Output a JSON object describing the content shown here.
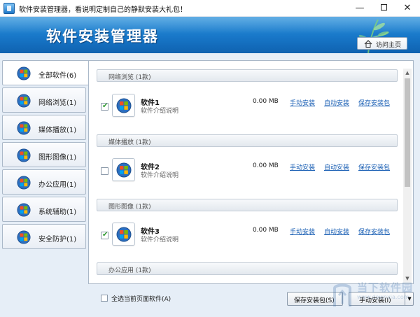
{
  "window": {
    "title": "软件安装管理器，看说明定制自己的静默安装大礼包！",
    "controls": {
      "minimize": "—",
      "maximize": "",
      "close": "✕"
    }
  },
  "banner": {
    "title": "软件安装管理器",
    "home_button": "访问主页",
    "colors": {
      "top": "#2e93dc",
      "bottom": "#0f62b0"
    }
  },
  "sidebar": {
    "items": [
      {
        "label": "全部软件(6)",
        "icon": "windows-logo-icon"
      },
      {
        "label": "网络浏览(1)",
        "icon": "windows-logo-icon"
      },
      {
        "label": "媒体播放(1)",
        "icon": "windows-logo-icon"
      },
      {
        "label": "图形图像(1)",
        "icon": "windows-logo-icon"
      },
      {
        "label": "办公应用(1)",
        "icon": "windows-logo-icon"
      },
      {
        "label": "系统辅助(1)",
        "icon": "windows-logo-icon"
      },
      {
        "label": "安全防护(1)",
        "icon": "windows-logo-icon"
      }
    ],
    "selected": "全部软件(6)"
  },
  "categories": [
    {
      "header": "网络浏览 (1款)"
    },
    {
      "header": "媒体播放 (1款)"
    },
    {
      "header": "图形图像 (1款)"
    },
    {
      "header": "办公应用 (1款)"
    }
  ],
  "software": [
    {
      "name": "软件1",
      "desc": "软件介绍说明",
      "size": "0.00 MB",
      "checked": true,
      "check_mark": "✔",
      "manual": "手动安装",
      "auto": "自动安装",
      "save": "保存安装包"
    },
    {
      "name": "软件2",
      "desc": "软件介绍说明",
      "size": "0.00 MB",
      "checked": false,
      "check_mark": "",
      "manual": "手动安装",
      "auto": "自动安装",
      "save": "保存安装包"
    },
    {
      "name": "软件3",
      "desc": "软件介绍说明",
      "size": "0.00 MB",
      "checked": true,
      "check_mark": "✔",
      "manual": "手动安装",
      "auto": "自动安装",
      "save": "保存安装包"
    }
  ],
  "footer": {
    "select_all": "全选当前页面软件(A)",
    "save_button": "保存安装包(S)",
    "manual_button": "手动安装(I)",
    "dropdown_caret": "▼"
  },
  "scrollbar": {
    "up": "▲",
    "down": "▼"
  },
  "watermark": {
    "text": "当下软件园",
    "url": "www.downxia.com"
  }
}
